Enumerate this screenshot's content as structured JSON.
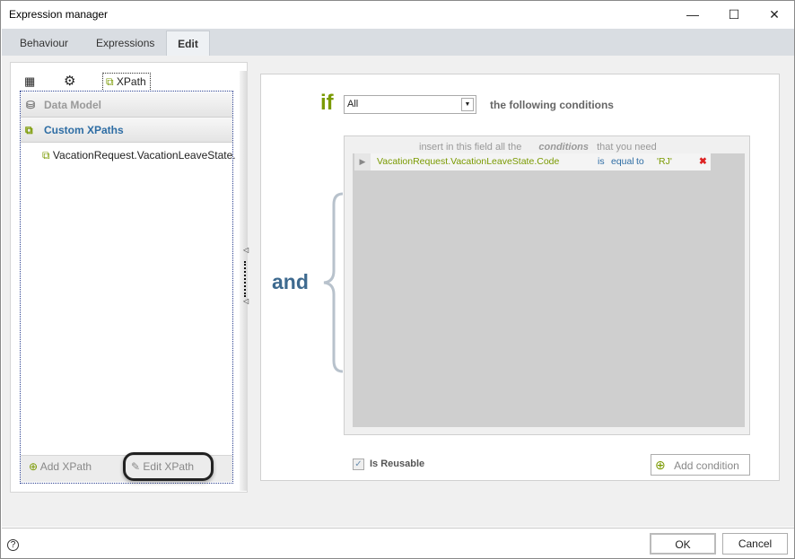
{
  "window": {
    "title": "Expression manager",
    "minimize": "—",
    "maximize": "☐",
    "close": "✕"
  },
  "tabs": [
    {
      "label": "Behaviour"
    },
    {
      "label": "Expressions"
    },
    {
      "label": "Edit",
      "active": true
    }
  ],
  "left": {
    "toolbar": {
      "xpath_label": "XPath"
    },
    "sections": [
      {
        "label": "Data Model"
      },
      {
        "label": "Custom XPaths"
      }
    ],
    "items": [
      {
        "label": "VacationRequest.VacationLeaveState."
      }
    ],
    "add_xpath": "Add XPath",
    "edit_xpath": "Edit XPath"
  },
  "rule": {
    "if_label": "if",
    "match_value": "All",
    "following": "the following conditions",
    "and_label": "and",
    "hint_pre": "insert in this field all the",
    "hint_em": "conditions",
    "hint_post": "that you need",
    "conditions": [
      {
        "field": "VacationRequest.VacationLeaveState.Code",
        "op1": "is",
        "op2": "equal",
        "op3": "to",
        "value": "'RJ'"
      }
    ],
    "is_reusable_label": "Is Reusable",
    "is_reusable": true,
    "add_condition": "Add condition"
  },
  "footer": {
    "ok": "OK",
    "cancel": "Cancel",
    "help": "?"
  },
  "colors": {
    "accent": "#2e6da4",
    "green": "#7a9a01",
    "and": "#3e6a8f"
  }
}
